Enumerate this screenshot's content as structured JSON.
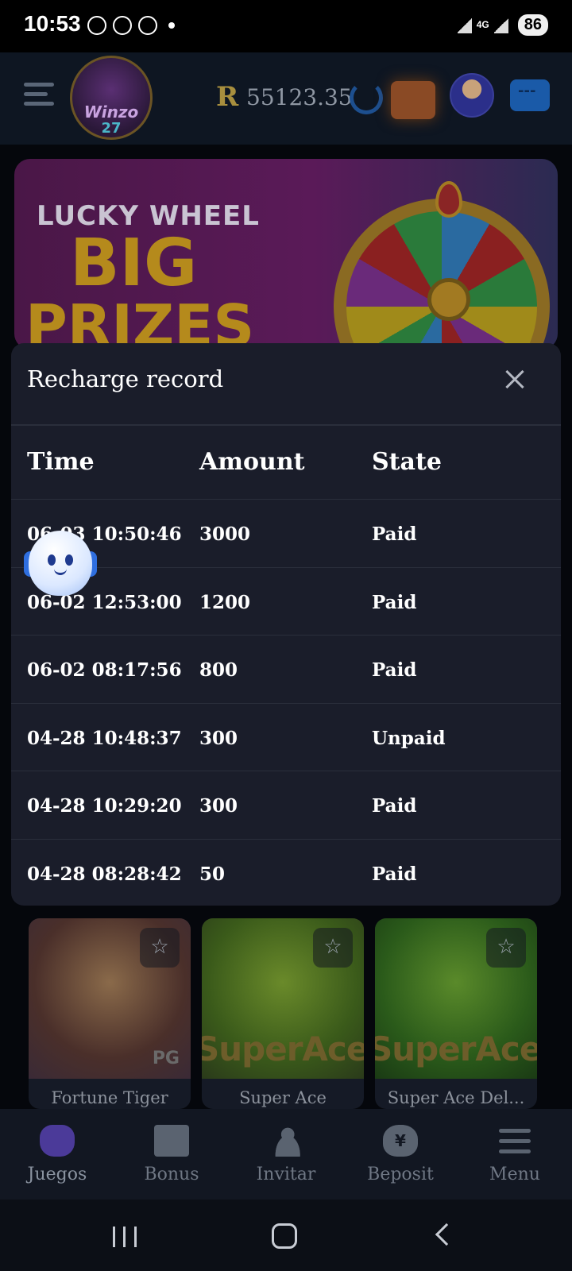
{
  "status_bar": {
    "time": "10:53",
    "network": "4G",
    "battery": "86"
  },
  "header": {
    "logo_text": "Winzo",
    "logo_sub": "27",
    "currency_symbol": "R",
    "balance": "55123.35"
  },
  "banner": {
    "line1": "LUCKY WHEEL",
    "line2": "BIG",
    "line3": "PRIZES"
  },
  "modal": {
    "title": "Recharge record",
    "columns": [
      "Time",
      "Amount",
      "State"
    ],
    "rows": [
      {
        "time": "06-03 10:50:46",
        "amount": "3000",
        "state": "Paid"
      },
      {
        "time": "06-02 12:53:00",
        "amount": "1200",
        "state": "Paid"
      },
      {
        "time": "06-02 08:17:56",
        "amount": "800",
        "state": "Paid"
      },
      {
        "time": "04-28 10:48:37",
        "amount": "300",
        "state": "Unpaid"
      },
      {
        "time": "04-28 10:29:20",
        "amount": "300",
        "state": "Paid"
      },
      {
        "time": "04-28 08:28:42",
        "amount": "50",
        "state": "Paid"
      }
    ]
  },
  "games": [
    {
      "name": "Fortune Tiger",
      "art_text": "",
      "badge": "PG"
    },
    {
      "name": "Super Ace",
      "art_text": "SuperAce",
      "badge": ""
    },
    {
      "name": "Super Ace Del...",
      "art_text": "SuperAce",
      "badge": ""
    }
  ],
  "bottom_nav": {
    "items": [
      {
        "label": "Juegos",
        "icon": "gamepad-icon",
        "active": true
      },
      {
        "label": "Bonus",
        "icon": "gift-icon",
        "active": false
      },
      {
        "label": "Invitar",
        "icon": "users-icon",
        "active": false
      },
      {
        "label": "Beposit",
        "icon": "money-bag-icon",
        "active": false,
        "icon_glyph": "¥"
      },
      {
        "label": "Menu",
        "icon": "menu-icon",
        "active": false
      }
    ]
  },
  "colors": {
    "modal_bg": "#1a1d2a",
    "app_bg": "#0e1622",
    "active_nav": "#4b3a99"
  }
}
